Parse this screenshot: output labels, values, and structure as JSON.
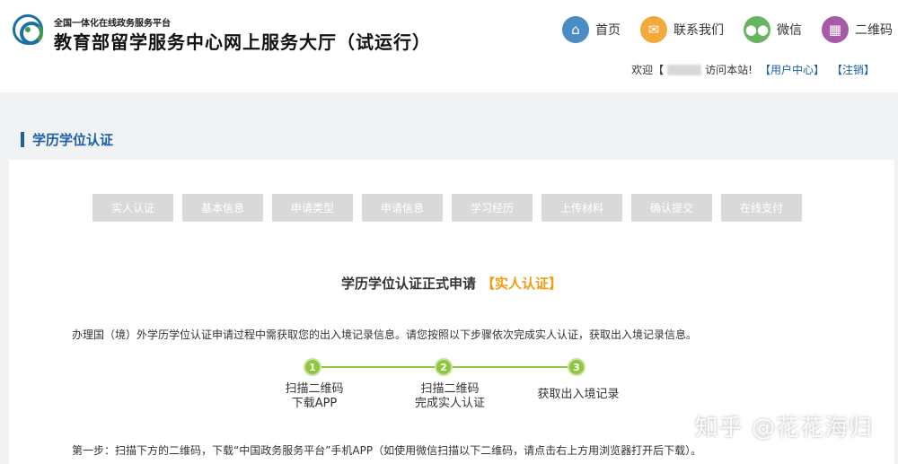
{
  "header": {
    "subtitle": "全国一体化在线政务服务平台",
    "title": "教育部留学服务中心网上服务大厅（试运行）",
    "nav": [
      {
        "label": "首页",
        "icon": "home-icon",
        "color": "#4a8cc4"
      },
      {
        "label": "联系我们",
        "icon": "mail-icon",
        "color": "#f2a83b"
      },
      {
        "label": "微信",
        "icon": "wechat-icon",
        "color": "#67b561"
      },
      {
        "label": "二维码",
        "icon": "qrcode-icon",
        "color": "#a65aa8"
      }
    ],
    "welcome": {
      "prefix": "欢迎【",
      "suffix": "访问本站!",
      "user_center": "【用户中心】",
      "logout": "【注销】"
    }
  },
  "section": {
    "title": "学历学位认证"
  },
  "tabs": [
    "实人认证",
    "基本信息",
    "申请类型",
    "申请信息",
    "学习经历",
    "上传材料",
    "确认提交",
    "在线支付"
  ],
  "form": {
    "heading": "学历学位认证正式申请",
    "highlight": "【实人认证】",
    "intro": "办理国（境）外学历学位认证申请过程中需获取您的出入境记录信息。请您按照以下步骤依次完成实人认证，获取出入境记录信息。",
    "steps": [
      {
        "num": "1",
        "line1": "扫描二维码",
        "line2": "下载APP"
      },
      {
        "num": "2",
        "line1": "扫描二维码",
        "line2": "完成实人认证"
      },
      {
        "num": "3",
        "line1": "获取出入境记录",
        "line2": ""
      }
    ],
    "step1_text": "第一步：扫描下方的二维码，下载“中国政务服务平台”手机APP（如使用微信扫描以下二维码，请点击右上方用浏览器打开后下载）。"
  },
  "watermark": "知乎 @花花海归"
}
